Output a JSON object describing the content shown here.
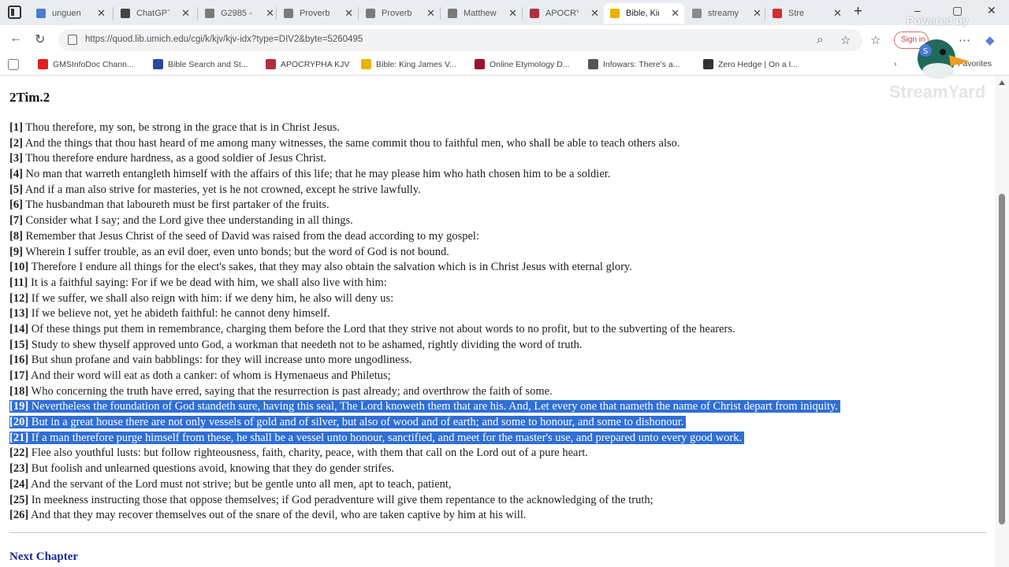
{
  "tabs": [
    {
      "label": "unguen",
      "favicon_color": "#4a7bd0"
    },
    {
      "label": "ChatGPT",
      "favicon_color": "#444444"
    },
    {
      "label": "G2985 -",
      "favicon_color": "#7a7a7a"
    },
    {
      "label": "Proverb",
      "favicon_color": "#7a7a7a"
    },
    {
      "label": "Proverb",
      "favicon_color": "#7a7a7a"
    },
    {
      "label": "Matthew",
      "favicon_color": "#7a7a7a"
    },
    {
      "label": "APOCRY",
      "favicon_color": "#b03040"
    },
    {
      "label": "Bible, Kir",
      "favicon_color": "#e8b400",
      "active": true
    },
    {
      "label": "streamy",
      "favicon_color": "#8a8a8a"
    },
    {
      "label": "Stre",
      "favicon_color": "#d03030"
    }
  ],
  "address_bar": {
    "url": "https://quod.lib.umich.edu/cgi/k/kjv/kjv-idx?type=DIV2&byte=5260495",
    "signin_label": "Sign in"
  },
  "bookmarks": [
    {
      "label": "GMSInfoDoc Chann...",
      "favicon_color": "#e02020"
    },
    {
      "label": "Bible Search and St...",
      "favicon_color": "#2a4aa0"
    },
    {
      "label": "APOCRYPHA KJV",
      "favicon_color": "#b03040"
    },
    {
      "label": "Bible: King James V...",
      "favicon_color": "#e8b400"
    },
    {
      "label": "Online Etymology D...",
      "favicon_color": "#a01030"
    },
    {
      "label": "Infowars: There's a...",
      "favicon_color": "#555555"
    },
    {
      "label": "Zero Hedge | On a l...",
      "favicon_color": "#333333"
    }
  ],
  "bookmarks_more": "Favorites",
  "overlay": {
    "powered_by": "Powered by",
    "brand": "StreamYard"
  },
  "page": {
    "chapter_title": "2Tim.2",
    "verses": [
      {
        "num": "[1]",
        "text": "Thou therefore, my son, be strong in the grace that is in Christ Jesus."
      },
      {
        "num": "[2]",
        "text": "And the things that thou hast heard of me among many witnesses, the same commit thou to faithful men, who shall be able to teach others also."
      },
      {
        "num": "[3]",
        "text": "Thou therefore endure hardness, as a good soldier of Jesus Christ."
      },
      {
        "num": "[4]",
        "text": "No man that warreth entangleth himself with the affairs of this life; that he may please him who hath chosen him to be a soldier."
      },
      {
        "num": "[5]",
        "text": "And if a man also strive for masteries, yet is he not crowned, except he strive lawfully."
      },
      {
        "num": "[6]",
        "text": "The husbandman that laboureth must be first partaker of the fruits."
      },
      {
        "num": "[7]",
        "text": "Consider what I say; and the Lord give thee understanding in all things."
      },
      {
        "num": "[8]",
        "text": "Remember that Jesus Christ of the seed of David was raised from the dead according to my gospel:"
      },
      {
        "num": "[9]",
        "text": "Wherein I suffer trouble, as an evil doer, even unto bonds; but the word of God is not bound."
      },
      {
        "num": "[10]",
        "text": "Therefore I endure all things for the elect's sakes, that they may also obtain the salvation which is in Christ Jesus with eternal glory."
      },
      {
        "num": "[11]",
        "text": "It is a faithful saying: For if we be dead with him, we shall also live with him:"
      },
      {
        "num": "[12]",
        "text": "If we suffer, we shall also reign with him: if we deny him, he also will deny us:"
      },
      {
        "num": "[13]",
        "text": "If we believe not, yet he abideth faithful: he cannot deny himself."
      },
      {
        "num": "[14]",
        "text": "Of these things put them in remembrance, charging them before the Lord that they strive not about words to no profit, but to the subverting of the hearers."
      },
      {
        "num": "[15]",
        "text": "Study to shew thyself approved unto God, a workman that needeth not to be ashamed, rightly dividing the word of truth."
      },
      {
        "num": "[16]",
        "text": "But shun profane and vain babblings: for they will increase unto more ungodliness."
      },
      {
        "num": "[17]",
        "text": "And their word will eat as doth a canker: of whom is Hymenaeus and Philetus;"
      },
      {
        "num": "[18]",
        "text": "Who concerning the truth have erred, saying that the resurrection is past already; and overthrow the faith of some."
      },
      {
        "num": "[19]",
        "text": "Nevertheless the foundation of God standeth sure, having this seal, The Lord knoweth them that are his. And, Let every one that nameth the name of Christ depart from iniquity.",
        "selected": true
      },
      {
        "num": "[20]",
        "text": "But in a great house there are not only vessels of gold and of silver, but also of wood and of earth; and some to honour, and some to dishonour.",
        "selected": true
      },
      {
        "num": "[21]",
        "text": "If a man therefore purge himself from these, he shall be a vessel unto honour, sanctified, and meet for the master's use, and prepared unto every good work.",
        "selected": true
      },
      {
        "num": "[22]",
        "text": "Flee also youthful lusts: but follow righteousness, faith, charity, peace, with them that call on the Lord out of a pure heart."
      },
      {
        "num": "[23]",
        "text": "But foolish and unlearned questions avoid, knowing that they do gender strifes."
      },
      {
        "num": "[24]",
        "text": "And the servant of the Lord must not strive; but be gentle unto all men, apt to teach, patient,"
      },
      {
        "num": "[25]",
        "text": "In meekness instructing those that oppose themselves; if God peradventure will give them repentance to the acknowledging of the truth;"
      },
      {
        "num": "[26]",
        "text": "And that they may recover themselves out of the snare of the devil, who are taken captive by him at his will."
      }
    ],
    "next_chapter": "Next Chapter"
  },
  "colors": {
    "selection": "#2f6fd6",
    "link": "#1a2a9a"
  },
  "icons": [
    "workspaces-icon",
    "back-icon",
    "refresh-icon",
    "lock-icon",
    "zoom-icon",
    "star-icon",
    "favorites-icon",
    "menu-icon",
    "copilot-icon",
    "duck-icon"
  ]
}
